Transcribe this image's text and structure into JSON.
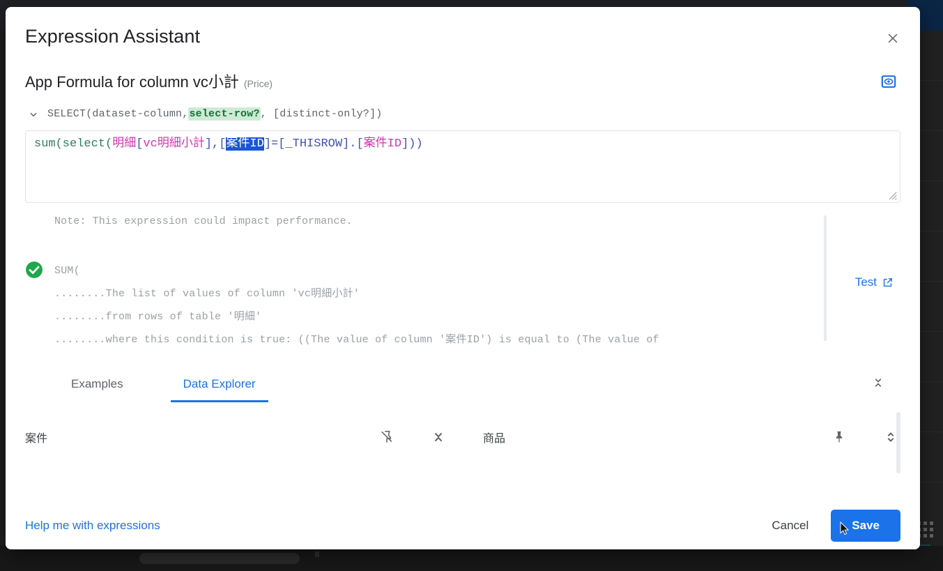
{
  "modal": {
    "title": "Expression Assistant",
    "close_icon": "close-icon"
  },
  "formula": {
    "heading": "App Formula for column vc小計",
    "heading_suffix": "(Price)",
    "preview_icon": "preview-eye-icon",
    "signature": {
      "caret_icon": "chevron-down-icon",
      "prefix": "SELECT(dataset-column, ",
      "highlight": "select-row?",
      "suffix": ", [distinct-only?])"
    },
    "expression": {
      "p1": "sum(select(",
      "p2": "明細",
      "p3": "[",
      "p4": "vc明細小計",
      "p5": "],[",
      "p6_selected": "案件ID",
      "p7": "]=[",
      "p8": "_THISROW",
      "p9": "].[",
      "p10": "案件ID",
      "p11": "]))",
      "resize_icon": "resize-grip-icon"
    }
  },
  "result": {
    "note": "Note: This expression could impact performance.",
    "status_icon": "check-circle-icon",
    "lines": [
      "SUM(",
      "........The list of values of column 'vc明細小計'",
      "........from rows of table '明細'",
      "........where this condition is true: ((The value of column '案件ID') is equal to (The value of"
    ],
    "test_label": "Test",
    "test_icon": "open-in-new-icon"
  },
  "tabs": {
    "items": [
      {
        "label": "Examples",
        "active": false
      },
      {
        "label": "Data Explorer",
        "active": true
      }
    ],
    "collapse_icon": "collapse-vertical-icon"
  },
  "explorer": {
    "groups": [
      {
        "label": "案件",
        "pin_icon": "pin-off-icon",
        "expand_icon": "collapse-vertical-icon"
      },
      {
        "label": "商品",
        "pin_icon": "pin-icon",
        "expand_icon": "unfold-more-icon"
      }
    ],
    "scrollbar": "explorer-scrollbar"
  },
  "footer": {
    "help_link": "Help me with expressions",
    "cancel_label": "Cancel",
    "save_label": "Save"
  },
  "background": {
    "toolbar_icons": [
      "tablet-icon",
      "help-circle-icon",
      "building-icon",
      "add-person-icon",
      "undo-icon",
      "redo-icon",
      "check-icon"
    ]
  },
  "colors": {
    "accent_blue": "#1a73e8",
    "selection_blue": "#1a56d6",
    "success_green": "#1e8e3e",
    "token_function": "#2e7d5b",
    "token_column": "#d633b0",
    "token_punct": "#3f51b5",
    "highlight_green_bg": "#ceead6"
  }
}
